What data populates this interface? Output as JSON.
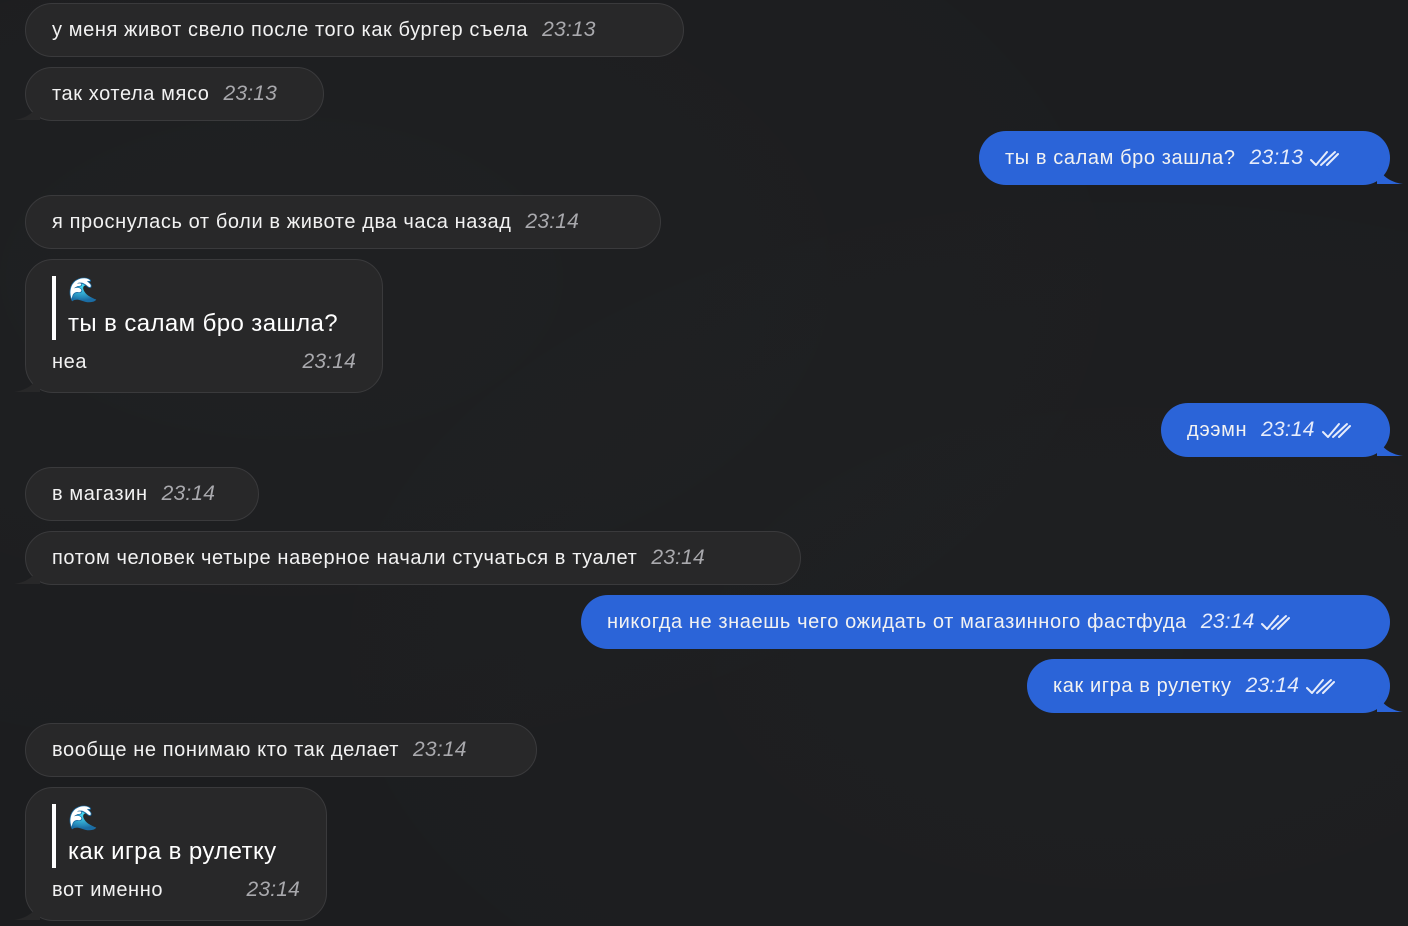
{
  "chat": {
    "messages": [
      {
        "text": "у меня живот свело после того как бургер съела",
        "time": "23:13"
      },
      {
        "text": "так хотела мясо",
        "time": "23:13"
      },
      {
        "text": "ты в салам бро зашла?",
        "time": "23:13"
      },
      {
        "text": "я проснулась от боли в животе два часа назад",
        "time": "23:14"
      },
      {
        "reply_emoji": "🌊",
        "reply_to": "ты в салам бро зашла?",
        "text": "неа",
        "time": "23:14"
      },
      {
        "text": "дээмн",
        "time": "23:14"
      },
      {
        "text": "в магазин",
        "time": "23:14"
      },
      {
        "text": "потом человек четыре наверное начали стучаться в туалет",
        "time": "23:14"
      },
      {
        "text": "никогда не знаешь чего ожидать от магазинного фастфуда",
        "time": "23:14"
      },
      {
        "text": "как игра в рулетку",
        "time": "23:14"
      },
      {
        "text": "вообще не понимаю кто так делает",
        "time": "23:14"
      },
      {
        "reply_emoji": "🌊",
        "reply_to": "как игра в рулетку",
        "text": "вот именно",
        "time": "23:14"
      }
    ]
  },
  "colors": {
    "background": "#1c1d1f",
    "incoming_bubble": "#282829",
    "outgoing_bubble": "#2b64d8"
  },
  "icons": {
    "read_receipt": "double-check-icon",
    "reply_avatar": "wave-emoji"
  }
}
